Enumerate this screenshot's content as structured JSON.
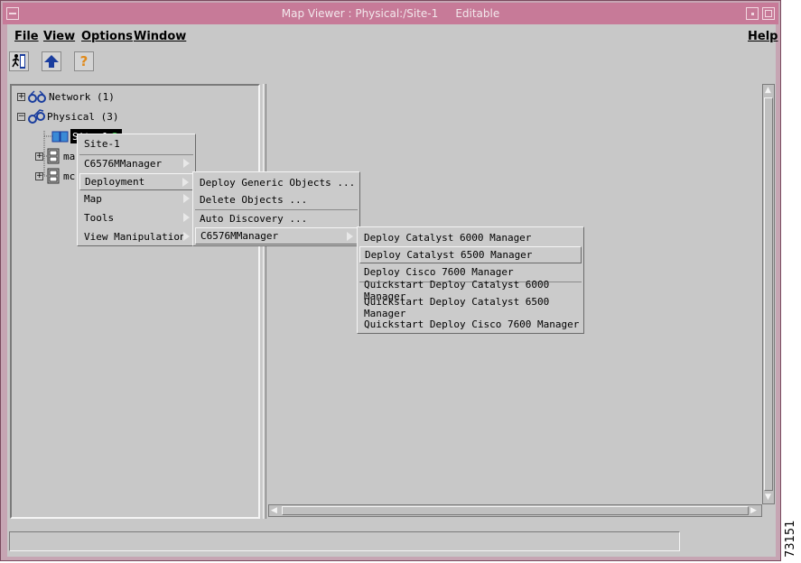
{
  "window": {
    "title": "Map Viewer : Physical:/Site-1     Editable"
  },
  "menubar": {
    "file": "File",
    "view": "View",
    "options": "Options",
    "window": "Window",
    "help": "Help"
  },
  "toolbar": {
    "buttons": [
      "exit-icon",
      "up-arrow-icon",
      "help-icon"
    ],
    "help_glyph": "?"
  },
  "tree": {
    "network": "Network (1)",
    "physical": "Physical (3)",
    "site": "Site-1",
    "child1_partial": "ma",
    "child2_partial": "mc"
  },
  "context_menu": {
    "items": [
      "Site-1",
      "C6576MManager",
      "Deployment",
      "Map",
      "Tools",
      "View Manipulation"
    ]
  },
  "deployment_menu": {
    "items": [
      "Deploy Generic Objects ...",
      "Delete Objects ...",
      "Auto Discovery ...",
      "C6576MManager"
    ]
  },
  "manager_menu": {
    "items": [
      "Deploy Catalyst 6000 Manager",
      "Deploy Catalyst 6500 Manager",
      "Deploy Cisco 7600 Manager",
      "Quickstart Deploy Catalyst 6000 Manager",
      "Quickstart Deploy Catalyst 6500 Manager",
      "Quickstart Deploy Cisco 7600 Manager"
    ]
  },
  "status": {
    "text": ""
  },
  "figure_number": "73151",
  "colors": {
    "titlebar": "#c77a98",
    "frame": "#c6a5b3",
    "client": "#c8c8c8",
    "selection": "#000000"
  }
}
